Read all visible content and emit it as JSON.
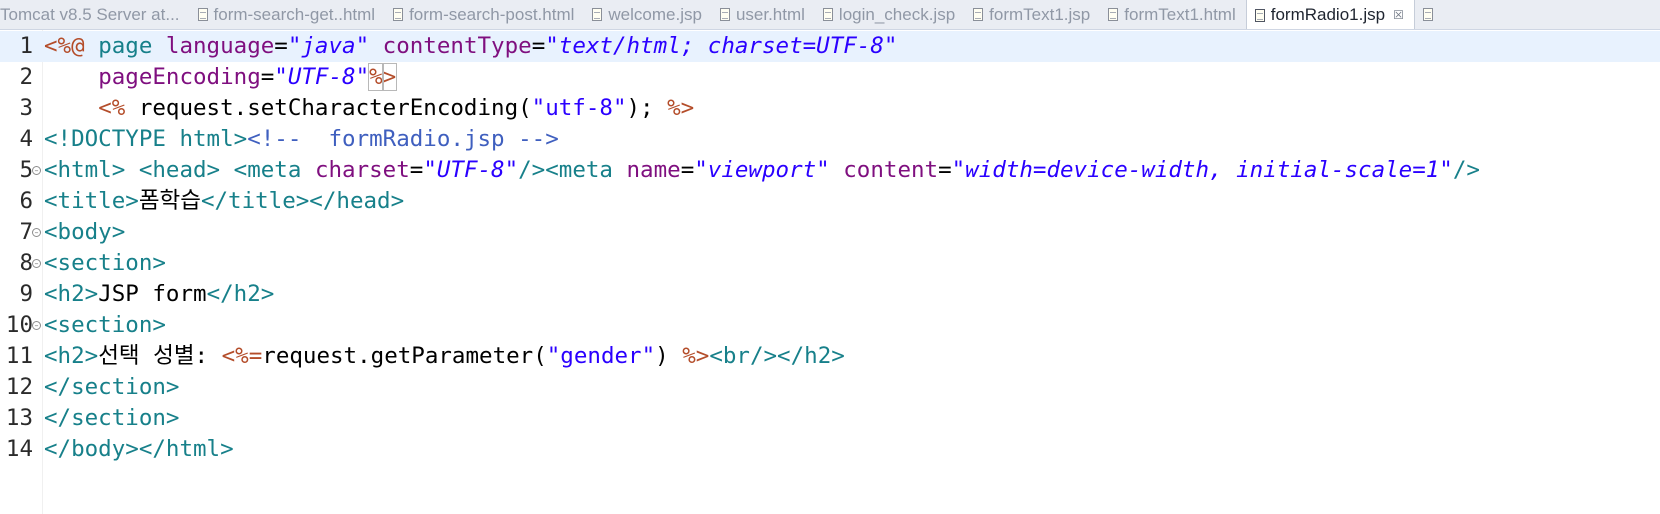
{
  "tabs": [
    {
      "label": "Tomcat v8.5 Server at...",
      "icon": "server-icon",
      "active": false
    },
    {
      "label": "form-search-get..html",
      "icon": "file-icon",
      "active": false
    },
    {
      "label": "form-search-post.html",
      "icon": "file-icon",
      "active": false
    },
    {
      "label": "welcome.jsp",
      "icon": "file-icon",
      "active": false
    },
    {
      "label": "user.html",
      "icon": "file-icon",
      "active": false
    },
    {
      "label": "login_check.jsp",
      "icon": "file-icon",
      "active": false
    },
    {
      "label": "formText1.jsp",
      "icon": "file-icon",
      "active": false
    },
    {
      "label": "formText1.html",
      "icon": "file-icon",
      "active": false
    },
    {
      "label": "formRadio1.jsp",
      "icon": "file-icon",
      "active": true,
      "close": "☒"
    }
  ],
  "editor": {
    "colors": {
      "tag": "#17808a",
      "attribute": "#7f0f7f",
      "string": "#2a00ff",
      "jsp_delimiter": "#b44d2a",
      "comment": "#3f5fbf",
      "current_line": "#e8f2fe"
    },
    "lines": [
      {
        "n": "1",
        "fold": "",
        "current": true,
        "tokens": [
          {
            "c": "jspd",
            "t": "<%@"
          },
          {
            "c": "plain",
            "t": " "
          },
          {
            "c": "tag",
            "t": "page"
          },
          {
            "c": "plain",
            "t": " "
          },
          {
            "c": "attr",
            "t": "language"
          },
          {
            "c": "plain",
            "t": "="
          },
          {
            "c": "str",
            "t": "\"java\""
          },
          {
            "c": "plain",
            "t": " "
          },
          {
            "c": "attr",
            "t": "contentType"
          },
          {
            "c": "plain",
            "t": "="
          },
          {
            "c": "str",
            "t": "\"text/html; charset=UTF-8\""
          }
        ]
      },
      {
        "n": "2",
        "fold": "",
        "current": false,
        "tokens": [
          {
            "c": "plain",
            "t": "    "
          },
          {
            "c": "attr",
            "t": "pageEncoding"
          },
          {
            "c": "plain",
            "t": "="
          },
          {
            "c": "str",
            "t": "\"UTF-8\""
          },
          {
            "c": "jspd",
            "t": "%",
            "box": true
          },
          {
            "c": "jspd",
            "t": ">",
            "box": true
          }
        ]
      },
      {
        "n": "3",
        "fold": "",
        "current": false,
        "tokens": [
          {
            "c": "plain",
            "t": "    "
          },
          {
            "c": "jspd",
            "t": "<%"
          },
          {
            "c": "plain",
            "t": " request.setCharacterEncoding("
          },
          {
            "c": "jstr",
            "t": "\"utf-8\""
          },
          {
            "c": "plain",
            "t": "); "
          },
          {
            "c": "jspd",
            "t": "%>"
          }
        ]
      },
      {
        "n": "4",
        "fold": "",
        "current": false,
        "tokens": [
          {
            "c": "tag",
            "t": "<!DOCTYPE html>"
          },
          {
            "c": "cmt",
            "t": "<!--  formRadio.jsp -->"
          }
        ]
      },
      {
        "n": "5",
        "fold": "⊖",
        "current": false,
        "tokens": [
          {
            "c": "tag",
            "t": "<html>"
          },
          {
            "c": "plain",
            "t": " "
          },
          {
            "c": "tag",
            "t": "<head>"
          },
          {
            "c": "plain",
            "t": " "
          },
          {
            "c": "tag",
            "t": "<meta"
          },
          {
            "c": "plain",
            "t": " "
          },
          {
            "c": "attr",
            "t": "charset"
          },
          {
            "c": "plain",
            "t": "="
          },
          {
            "c": "str",
            "t": "\"UTF-8\""
          },
          {
            "c": "tag",
            "t": "/><meta"
          },
          {
            "c": "plain",
            "t": " "
          },
          {
            "c": "attr",
            "t": "name"
          },
          {
            "c": "plain",
            "t": "="
          },
          {
            "c": "str",
            "t": "\"viewport\""
          },
          {
            "c": "plain",
            "t": " "
          },
          {
            "c": "attr",
            "t": "content"
          },
          {
            "c": "plain",
            "t": "="
          },
          {
            "c": "str",
            "t": "\"width=device-width, initial-scale=1\""
          },
          {
            "c": "tag",
            "t": "/>"
          }
        ]
      },
      {
        "n": "6",
        "fold": "",
        "current": false,
        "tokens": [
          {
            "c": "tag",
            "t": "<title>"
          },
          {
            "c": "plain",
            "t": "폼학습"
          },
          {
            "c": "tag",
            "t": "</title></head>"
          }
        ]
      },
      {
        "n": "7",
        "fold": "⊖",
        "current": false,
        "tokens": [
          {
            "c": "tag",
            "t": "<body>"
          }
        ]
      },
      {
        "n": "8",
        "fold": "⊖",
        "current": false,
        "tokens": [
          {
            "c": "tag",
            "t": "<section>"
          }
        ]
      },
      {
        "n": "9",
        "fold": "",
        "current": false,
        "tokens": [
          {
            "c": "tag",
            "t": "<h2>"
          },
          {
            "c": "plain",
            "t": "JSP form"
          },
          {
            "c": "tag",
            "t": "</h2>"
          }
        ]
      },
      {
        "n": "10",
        "fold": "⊖",
        "current": false,
        "tokens": [
          {
            "c": "tag",
            "t": "<section>"
          }
        ]
      },
      {
        "n": "11",
        "fold": "",
        "current": false,
        "tokens": [
          {
            "c": "tag",
            "t": "<h2>"
          },
          {
            "c": "plain",
            "t": "선택 성별: "
          },
          {
            "c": "jspd",
            "t": "<%="
          },
          {
            "c": "plain",
            "t": "request.getParameter("
          },
          {
            "c": "jstr",
            "t": "\"gender\""
          },
          {
            "c": "plain",
            "t": ") "
          },
          {
            "c": "jspd",
            "t": "%>"
          },
          {
            "c": "tag",
            "t": "<br/></h2>"
          }
        ]
      },
      {
        "n": "12",
        "fold": "",
        "current": false,
        "tokens": [
          {
            "c": "tag",
            "t": "</section>"
          }
        ]
      },
      {
        "n": "13",
        "fold": "",
        "current": false,
        "tokens": [
          {
            "c": "tag",
            "t": "</section>"
          }
        ]
      },
      {
        "n": "14",
        "fold": "",
        "current": false,
        "tokens": [
          {
            "c": "tag",
            "t": "</body></html>"
          }
        ]
      }
    ]
  }
}
